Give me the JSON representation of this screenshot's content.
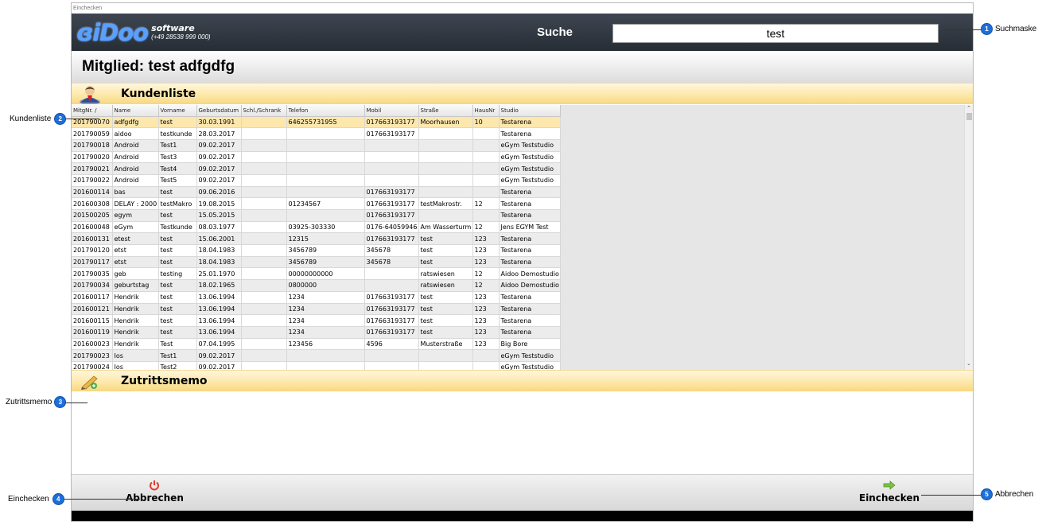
{
  "window": {
    "title": "Einchecken"
  },
  "header": {
    "logo_mark": "ɞiDoo",
    "logo_software": "software",
    "logo_phone": "(+49 28538 999 000)",
    "search_label": "Suche",
    "search_value": "test"
  },
  "member": {
    "title": "Mitglied: test adfgdfg"
  },
  "customer_list": {
    "title": "Kundenliste",
    "columns": [
      "MitgNr. /",
      "Name",
      "Vorname",
      "Geburtsdatum",
      "Schl./Schrank",
      "Telefon",
      "Mobil",
      "Straße",
      "HausNr",
      "Studio"
    ],
    "rows": [
      [
        "201790070",
        "adfgdfg",
        "test",
        "30.03.1991",
        "",
        "646255731955",
        "017663193177",
        "Moorhausen",
        "10",
        "Testarena"
      ],
      [
        "201790059",
        "aidoo",
        "testkunde",
        "28.03.2017",
        "",
        "",
        "017663193177",
        "",
        "",
        "Testarena"
      ],
      [
        "201790018",
        "Android",
        "Test1",
        "09.02.2017",
        "",
        "",
        "",
        "",
        "",
        "eGym Teststudio"
      ],
      [
        "201790020",
        "Android",
        "Test3",
        "09.02.2017",
        "",
        "",
        "",
        "",
        "",
        "eGym Teststudio"
      ],
      [
        "201790021",
        "Android",
        "Test4",
        "09.02.2017",
        "",
        "",
        "",
        "",
        "",
        "eGym Teststudio"
      ],
      [
        "201790022",
        "Android",
        "Test5",
        "09.02.2017",
        "",
        "",
        "",
        "",
        "",
        "eGym Teststudio"
      ],
      [
        "201600114",
        "bas",
        "test",
        "09.06.2016",
        "",
        "",
        "017663193177",
        "",
        "",
        "Testarena"
      ],
      [
        "201600308",
        "DELAY : 2000",
        "testMakro",
        "19.08.2015",
        "",
        "01234567",
        "017663193177",
        "testMakrostr.",
        "12",
        "Testarena"
      ],
      [
        "201500205",
        "egym",
        "test",
        "15.05.2015",
        "",
        "",
        "017663193177",
        "",
        "",
        "Testarena"
      ],
      [
        "201600048",
        "eGym",
        "Testkunde",
        "08.03.1977",
        "",
        "03925-303330",
        "0176-64059946",
        "Am Wasserturm",
        "12",
        "Jens EGYM Test"
      ],
      [
        "201600131",
        "etest",
        "test",
        "15.06.2001",
        "",
        "12315",
        "017663193177",
        "test",
        "123",
        "Testarena"
      ],
      [
        "201790120",
        "etst",
        "test",
        "18.04.1983",
        "",
        "3456789",
        "345678",
        "test",
        "123",
        "Testarena"
      ],
      [
        "201790117",
        "etst",
        "test",
        "18.04.1983",
        "",
        "3456789",
        "345678",
        "test",
        "123",
        "Testarena"
      ],
      [
        "201790035",
        "geb",
        "testing",
        "25.01.1970",
        "",
        "00000000000",
        "",
        "ratswiesen",
        "12",
        "Aidoo Demostudio"
      ],
      [
        "201790034",
        "geburtstag",
        "test",
        "18.02.1965",
        "",
        "0800000",
        "",
        "ratswiesen",
        "12",
        "Aidoo Demostudio"
      ],
      [
        "201600117",
        "Hendrik",
        "test",
        "13.06.1994",
        "",
        "1234",
        "017663193177",
        "test",
        "123",
        "Testarena"
      ],
      [
        "201600121",
        "Hendrik",
        "test",
        "13.06.1994",
        "",
        "1234",
        "017663193177",
        "test",
        "123",
        "Testarena"
      ],
      [
        "201600115",
        "Hendrik",
        "test",
        "13.06.1994",
        "",
        "1234",
        "017663193177",
        "test",
        "123",
        "Testarena"
      ],
      [
        "201600119",
        "Hendrik",
        "test",
        "13.06.1994",
        "",
        "1234",
        "017663193177",
        "test",
        "123",
        "Testarena"
      ],
      [
        "201600023",
        "Hendrik",
        "Test",
        "07.04.1995",
        "",
        "123456",
        "4596",
        "Musterstraße",
        "123",
        "Big Bore"
      ],
      [
        "201790023",
        "Ios",
        "Test1",
        "09.02.2017",
        "",
        "",
        "",
        "",
        "",
        "eGym Teststudio"
      ],
      [
        "201790024",
        "Ios",
        "Test2",
        "09.02.2017",
        "",
        "",
        "",
        "",
        "",
        "eGym Teststudio"
      ]
    ]
  },
  "memo": {
    "title": "Zutrittsmemo"
  },
  "footer": {
    "cancel_label": "Abbrechen",
    "checkin_label": "Einchecken"
  },
  "annotations": {
    "a1": {
      "num": "1",
      "label": "Suchmaske"
    },
    "a2": {
      "num": "2",
      "label": "Kundenliste"
    },
    "a3": {
      "num": "3",
      "label": "Zutrittsmemo"
    },
    "a4": {
      "num": "4",
      "label": "Einchecken"
    },
    "a5": {
      "num": "5",
      "label": "Abbrechen"
    }
  },
  "colors": {
    "accent_blue": "#1e6fd9",
    "header_dark": "#2c333c",
    "section_yellow": "#fde7a6",
    "selected_row": "#fde7ac"
  }
}
